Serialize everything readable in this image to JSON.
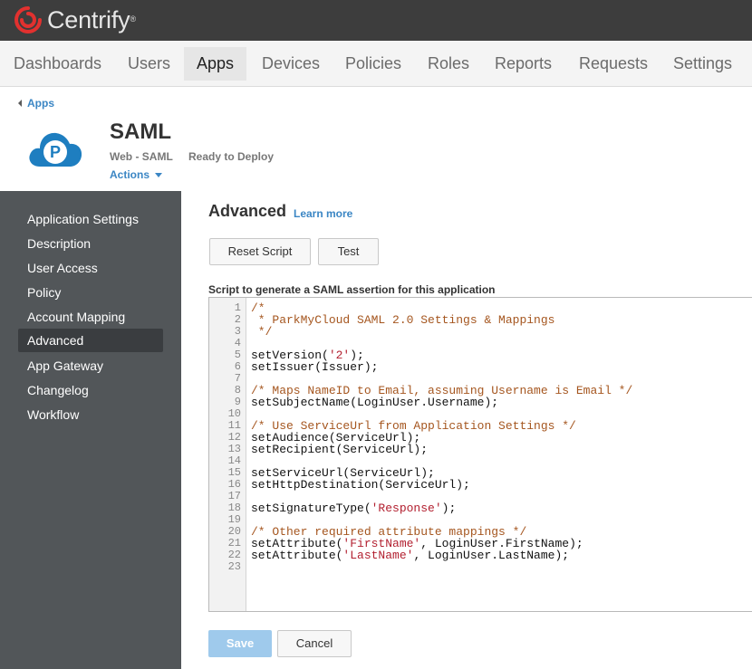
{
  "brand": {
    "name": "Centrify",
    "reg": "®"
  },
  "nav": {
    "tabs": [
      {
        "label": "Dashboards"
      },
      {
        "label": "Users"
      },
      {
        "label": "Apps",
        "active": true
      },
      {
        "label": "Devices"
      },
      {
        "label": "Policies"
      },
      {
        "label": "Roles"
      },
      {
        "label": "Reports"
      },
      {
        "label": "Requests"
      },
      {
        "label": "Settings"
      }
    ]
  },
  "header": {
    "breadcrumb": "Apps",
    "title": "SAML",
    "app_type": "Web - SAML",
    "status": "Ready to Deploy",
    "actions": "Actions",
    "icon": "parkmycloud-cloud-icon",
    "icon_letter": "P"
  },
  "sidebar": {
    "items": [
      {
        "label": "Application Settings"
      },
      {
        "label": "Description"
      },
      {
        "label": "User Access"
      },
      {
        "label": "Policy"
      },
      {
        "label": "Account Mapping"
      },
      {
        "label": "Advanced",
        "active": true
      },
      {
        "label": "App Gateway"
      },
      {
        "label": "Changelog"
      },
      {
        "label": "Workflow"
      }
    ]
  },
  "main": {
    "section_title": "Advanced",
    "learn_more": "Learn more",
    "reset_button": "Reset Script",
    "test_button": "Test",
    "script_label": "Script to generate a SAML assertion for this application",
    "save_button": "Save",
    "cancel_button": "Cancel"
  },
  "script": {
    "lines": [
      {
        "n": "1",
        "text": "/*",
        "type": "comment"
      },
      {
        "n": "2",
        "text": " * ParkMyCloud SAML 2.0 Settings & Mappings",
        "type": "comment"
      },
      {
        "n": "3",
        "text": " */",
        "type": "comment"
      },
      {
        "n": "4",
        "text": "",
        "type": "code"
      },
      {
        "n": "5",
        "text": "setVersion('2');",
        "type": "code"
      },
      {
        "n": "6",
        "text": "setIssuer(Issuer);",
        "type": "code"
      },
      {
        "n": "7",
        "text": "",
        "type": "code"
      },
      {
        "n": "8",
        "text": "/* Maps NameID to Email, assuming Username is Email */",
        "type": "comment"
      },
      {
        "n": "9",
        "text": "setSubjectName(LoginUser.Username);",
        "type": "code"
      },
      {
        "n": "10",
        "text": "",
        "type": "code"
      },
      {
        "n": "11",
        "text": "/* Use ServiceUrl from Application Settings */",
        "type": "comment"
      },
      {
        "n": "12",
        "text": "setAudience(ServiceUrl);",
        "type": "code"
      },
      {
        "n": "13",
        "text": "setRecipient(ServiceUrl);",
        "type": "code"
      },
      {
        "n": "14",
        "text": "",
        "type": "code"
      },
      {
        "n": "15",
        "text": "setServiceUrl(ServiceUrl);",
        "type": "code"
      },
      {
        "n": "16",
        "text": "setHttpDestination(ServiceUrl);",
        "type": "code"
      },
      {
        "n": "17",
        "text": "",
        "type": "code"
      },
      {
        "n": "18",
        "text": "setSignatureType('Response');",
        "type": "code"
      },
      {
        "n": "19",
        "text": "",
        "type": "code"
      },
      {
        "n": "20",
        "text": "/* Other required attribute mappings */",
        "type": "comment"
      },
      {
        "n": "21",
        "text": "setAttribute('FirstName', LoginUser.FirstName);",
        "type": "code"
      },
      {
        "n": "22",
        "text": "setAttribute('LastName', LoginUser.LastName);",
        "type": "code"
      },
      {
        "n": "23",
        "text": "",
        "type": "code"
      }
    ]
  },
  "colors": {
    "accent": "#3b86c4",
    "topbar": "#3d3d3d",
    "sidebar": "#525659",
    "brand_red": "#e2312f",
    "comment": "#a5561f",
    "string": "#b21f2f",
    "save_disabled": "#9fcaec"
  }
}
